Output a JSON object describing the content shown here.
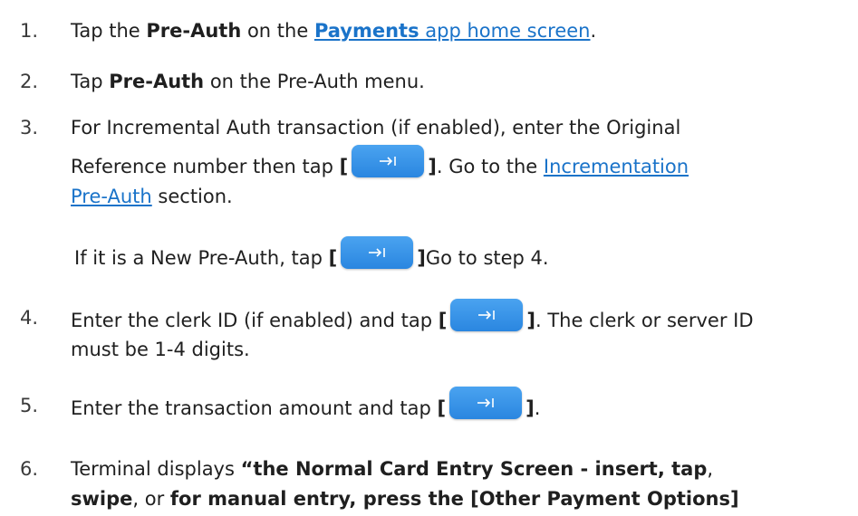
{
  "steps": [
    {
      "num": "1.",
      "pre": "Tap the ",
      "bold": "Pre-Auth",
      "mid": " on the ",
      "link_bold": "Payments",
      "link_rest": " app home screen",
      "post": "."
    },
    {
      "num": "2.",
      "pre": "Tap ",
      "bold": "Pre-Auth",
      "post": " on the Pre-Auth menu."
    },
    {
      "num": "3.",
      "line1": "For Incremental Auth transaction (if enabled), enter the Original",
      "line2_pre": "Reference number then tap ",
      "line2_post": ". Go to the ",
      "link1": "Incrementation",
      "link2": "Pre-Auth",
      "line3_post": " section.",
      "new_pre": "If it is a New Pre-Auth, tap ",
      "new_post": "Go to step 4."
    },
    {
      "num": "4.",
      "pre": "Enter the clerk ID (if enabled) and tap ",
      "post": ". The clerk or server ID",
      "line2": "must be 1-4 digits."
    },
    {
      "num": "5.",
      "pre": "Enter the transaction amount and tap ",
      "post": "."
    },
    {
      "num": "6.",
      "pre": "Terminal displays ",
      "bold1": "“the Normal Card Entry Screen - insert, tap",
      "comma": ",",
      "bold2": "swipe",
      "mid": ", or ",
      "bold3": "for manual entry,  press the [Other Payment Options]"
    }
  ],
  "bracket_open": "[",
  "bracket_close": "]",
  "button_icon": "tab-arrow-icon",
  "colors": {
    "link": "#1a73c9",
    "button": "#2a86e0"
  }
}
